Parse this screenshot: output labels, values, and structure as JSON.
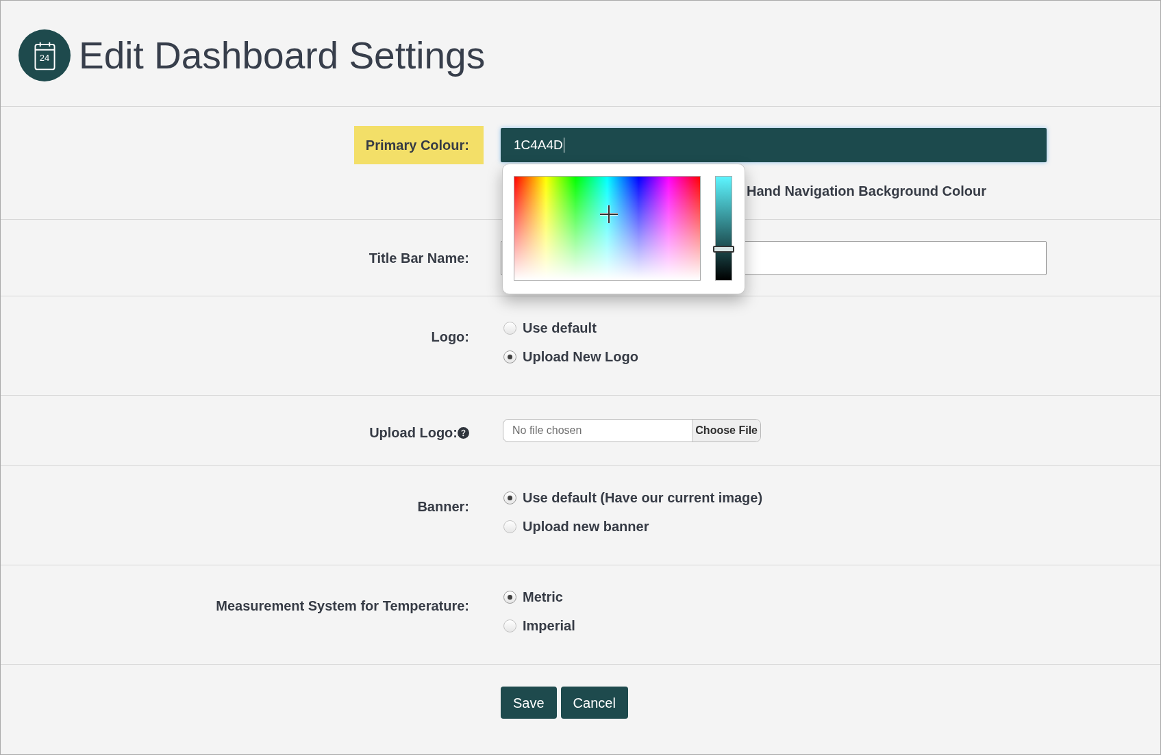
{
  "header": {
    "title": "Edit Dashboard Settings",
    "logo_text": "24"
  },
  "fields": [
    {
      "kind": "color",
      "label": "Primary Colour:",
      "highlighted": true,
      "value": "1C4A4D",
      "focused": true,
      "hint": "Hand Navigation Background Colour",
      "picker": {
        "open": true,
        "brightness": {
          "level": 0.3
        }
      }
    },
    {
      "kind": "text",
      "label": "Title Bar Name:"
    },
    {
      "kind": "radio",
      "label": "Logo:",
      "options": [
        {
          "label": "Use default",
          "selected": false
        },
        {
          "label": "Upload New Logo",
          "selected": true
        }
      ]
    },
    {
      "kind": "file",
      "label": "Upload Logo:",
      "help": true,
      "file_status": "No file chosen",
      "button": "Choose File"
    },
    {
      "kind": "radio",
      "label": "Banner:",
      "options": [
        {
          "label": "Use default (Have our current image)",
          "selected": true
        },
        {
          "label": "Upload new banner",
          "selected": false
        }
      ]
    },
    {
      "kind": "radio",
      "label": "Measurement System for Temperature:",
      "options": [
        {
          "label": "Metric",
          "selected": true
        },
        {
          "label": "Imperial",
          "selected": false
        }
      ]
    }
  ],
  "buttons": [
    {
      "label": "Save"
    },
    {
      "label": "Cancel"
    }
  ]
}
